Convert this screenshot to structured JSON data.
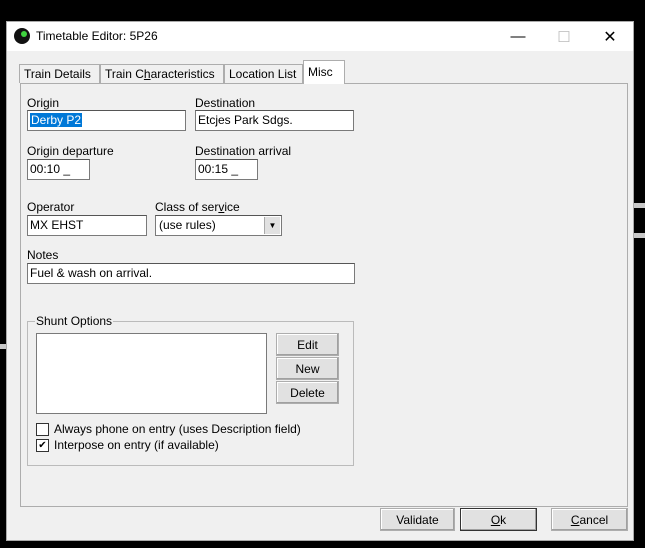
{
  "window": {
    "title": "Timetable Editor: 5P26",
    "minimize_glyph": "—",
    "maximize_glyph": "☐",
    "close_glyph": "✕"
  },
  "tabs": [
    {
      "label": "Train Details",
      "active": false
    },
    {
      "label_pre": "Train C",
      "label_u": "h",
      "label_post": "aracteristics",
      "active": false
    },
    {
      "label": "Location List",
      "active": false
    },
    {
      "label": "Misc",
      "active": true
    }
  ],
  "form": {
    "origin_label": "Origin",
    "origin_value": "Derby P2",
    "destination_label": "Destination",
    "destination_value": "Etcjes Park Sdgs.",
    "origin_departure_label": "Origin departure",
    "origin_departure_value": "00:10 _",
    "destination_arrival_label": "Destination arrival",
    "destination_arrival_value": "00:15 _",
    "operator_label": "Operator",
    "operator_value": "MX EHST",
    "class_label_pre": "Class of ser",
    "class_label_u": "v",
    "class_label_post": "ice",
    "class_value": "(use rules)",
    "notes_label": "Notes",
    "notes_value": "Fuel & wash on arrival."
  },
  "shunt": {
    "group_label": "Shunt Options",
    "edit_label": "Edit",
    "new_label": "New",
    "delete_label": "Delete",
    "always_phone_label": "Always phone on entry (uses Description field)",
    "always_phone_checked": false,
    "interpose_label": "Interpose on entry (if available)",
    "interpose_checked": true,
    "check_glyph": "✔"
  },
  "footer": {
    "validate_label": "Validate",
    "ok_label_u": "O",
    "ok_label_post": "k",
    "cancel_label_u": "C",
    "cancel_label_post": "ancel"
  },
  "colors": {
    "selection": "#0078d7",
    "window_bg": "#f0f0f0",
    "icon_green": "#3fd23f"
  }
}
